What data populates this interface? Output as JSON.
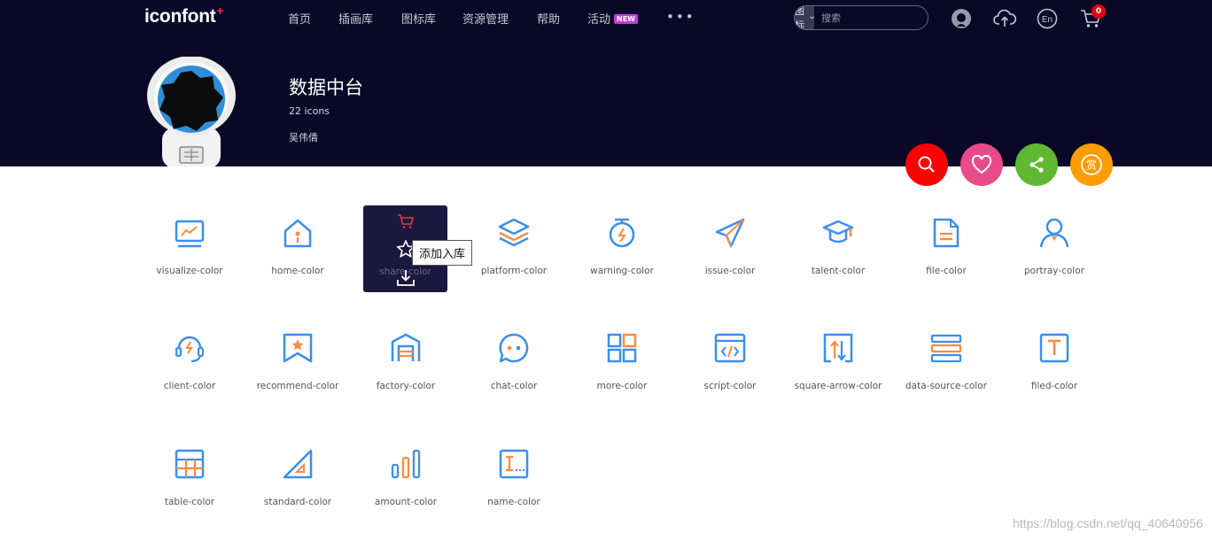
{
  "header": {
    "logo": "iconfont",
    "logo_plus": "+",
    "nav": [
      "首页",
      "插画库",
      "图标库",
      "资源管理",
      "帮助",
      "活动"
    ],
    "new_badge": "NEW",
    "more": "•••",
    "search": {
      "type": "图标",
      "placeholder": "搜索"
    },
    "lang": "En",
    "cart_count": "0"
  },
  "project": {
    "title": "数据中台",
    "count": "22 icons",
    "author": "吴伟倩"
  },
  "actions": [
    {
      "icon": "search-icon",
      "color": "#ff0000"
    },
    {
      "icon": "heart-icon",
      "color": "#e94a8a"
    },
    {
      "icon": "share-icon",
      "color": "#5fb832"
    },
    {
      "icon": "reward-icon",
      "color": "#ff9c00",
      "label": "赏"
    }
  ],
  "icons": [
    "visualize-color",
    "home-color",
    "share-color",
    "platform-color",
    "warning-color",
    "issue-color",
    "talent-color",
    "file-color",
    "portray-color",
    "client-color",
    "recommend-color",
    "factory-color",
    "chat-color",
    "more-color",
    "script-color",
    "square-arrow-color",
    "data-source-color",
    "filed-color",
    "table-color",
    "standard-color",
    "amount-color",
    "name-color"
  ],
  "hover": {
    "tooltip": "添加入库"
  },
  "colors": {
    "header_bg": "#0b0727",
    "icon_blue": "#3a8ef0",
    "icon_orange": "#fd8b3d"
  },
  "watermark": "https://blog.csdn.net/qq_40640956"
}
